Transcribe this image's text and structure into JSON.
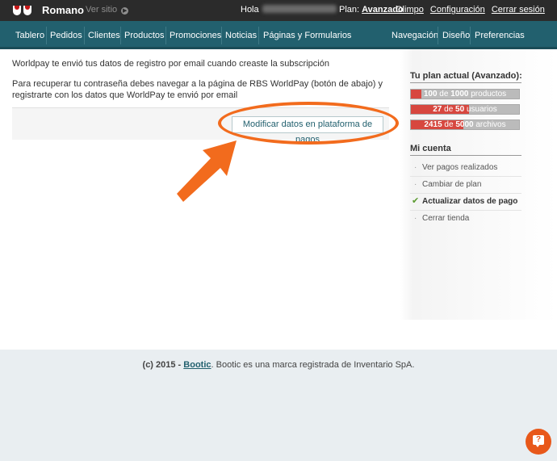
{
  "topbar": {
    "store_name": "Romano",
    "view_site": "Ver sitio",
    "hello": "Hola",
    "plan_label": "Plan:",
    "plan_name": "Avanzado",
    "links": [
      "Olimpo",
      "Configuración",
      "Cerrar sesión"
    ]
  },
  "nav": {
    "left": [
      "Tablero",
      "Pedidos",
      "Clientes",
      "Productos",
      "Promociones",
      "Noticias",
      "Páginas y Formularios"
    ],
    "right": [
      "Navegación",
      "Diseño",
      "Preferencias"
    ]
  },
  "main": {
    "message1": "Worldpay te envió tus datos de registro por email cuando creaste la subscripción",
    "message2": "Para recuperar tu contraseña debes navegar a la página de RBS WorldPay (botón de abajo) y registrarte con los datos que WorldPay te envió por email",
    "button": "Modificar datos en plataforma de pagos"
  },
  "sidebar": {
    "plan_title": "Tu plan actual (Avanzado):",
    "usage": [
      {
        "used": "100",
        "of": "de",
        "total": "1000",
        "unit": "productos",
        "fraction": 0.1
      },
      {
        "used": "27",
        "of": "de",
        "total": "50",
        "unit": "usuarios",
        "fraction": 0.54
      },
      {
        "used": "2415",
        "of": "de",
        "total": "5000",
        "unit": "archivos",
        "fraction": 0.483
      }
    ],
    "account_title": "Mi cuenta",
    "account_items": [
      {
        "label": "Ver pagos realizados",
        "active": false
      },
      {
        "label": "Cambiar de plan",
        "active": false
      },
      {
        "label": "Actualizar datos de pago",
        "active": true
      },
      {
        "label": "Cerrar tienda",
        "active": false
      }
    ]
  },
  "footer": {
    "prefix": "(c) 2015 -",
    "brand": "Bootic",
    "suffix": ". Bootic es una marca registrada de Inventario SpA."
  },
  "colors": {
    "topbar": "#2b2b2b",
    "navbar": "#22606e",
    "accent_orange": "#f26b1d",
    "usage_fill": "#d7473f",
    "footer_bg": "#e9eef1"
  },
  "icons": {
    "view_site": "arrow-right-circle-icon",
    "active_item": "checkmark-icon",
    "help": "chat-help-icon"
  }
}
